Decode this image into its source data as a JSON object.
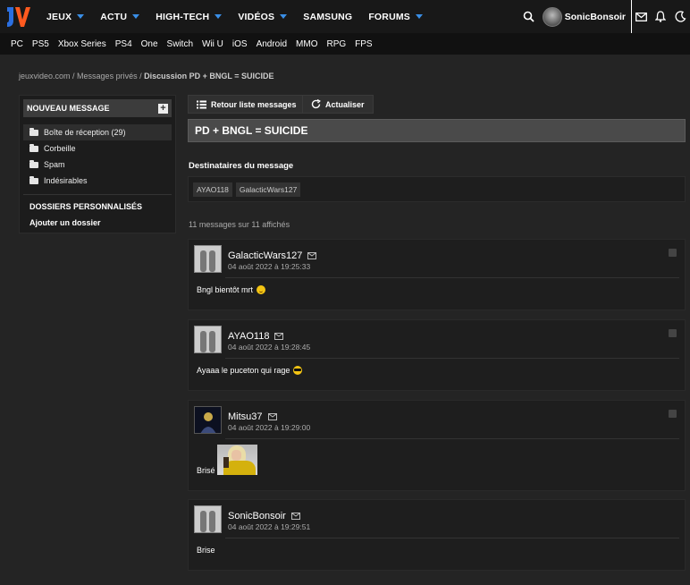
{
  "header": {
    "logo_text": "JV",
    "nav": [
      "JEUX",
      "ACTU",
      "HIGH-TECH",
      "VIDÉOS",
      "SAMSUNG",
      "FORUMS"
    ],
    "nav_dropdown": [
      true,
      true,
      true,
      true,
      false,
      true
    ],
    "username": "SonicBonsoir"
  },
  "subnav": [
    "PC",
    "PS5",
    "Xbox Series",
    "PS4",
    "One",
    "Switch",
    "Wii U",
    "iOS",
    "Android",
    "MMO",
    "RPG",
    "FPS"
  ],
  "breadcrumb": {
    "site": "jeuxvideo.com",
    "sep1": " / ",
    "section": "Messages privés",
    "sep2": " / ",
    "current": "Discussion PD + BNGL = SUICIDE"
  },
  "sidebar": {
    "new_message": "NOUVEAU MESSAGE",
    "folders": [
      "Boîte de réception (29)",
      "Corbeille",
      "Spam",
      "Indésirables"
    ],
    "custom_title": "DOSSIERS PERSONNALISÉS",
    "add_folder": "Ajouter un dossier"
  },
  "toolbar": {
    "back_label": "Retour liste messages",
    "refresh_label": "Actualiser"
  },
  "discussion": {
    "title": "PD + BNGL = SUICIDE",
    "recipients_label": "Destinataires du message",
    "recipients": [
      "AYAO118",
      "GalacticWars127"
    ],
    "count_text": "11 messages sur 11 affichés"
  },
  "messages": [
    {
      "author": "GalacticWars127",
      "date": "04 août 2022 à 19:25:33",
      "body": "Bngl bientôt mrt"
    },
    {
      "author": "AYAO118",
      "date": "04 août 2022 à 19:28:45",
      "body": "Ayaaa le puceton qui rage"
    },
    {
      "author": "Mitsu37",
      "date": "04 août 2022 à 19:29:00",
      "body": "Brisé"
    },
    {
      "author": "SonicBonsoir",
      "date": "04 août 2022 à 19:29:51",
      "body": "Brise"
    }
  ],
  "colors": {
    "accent": "#3a8ee6",
    "logo_orange": "#ff5a1f",
    "logo_blue": "#2b6fe0"
  }
}
